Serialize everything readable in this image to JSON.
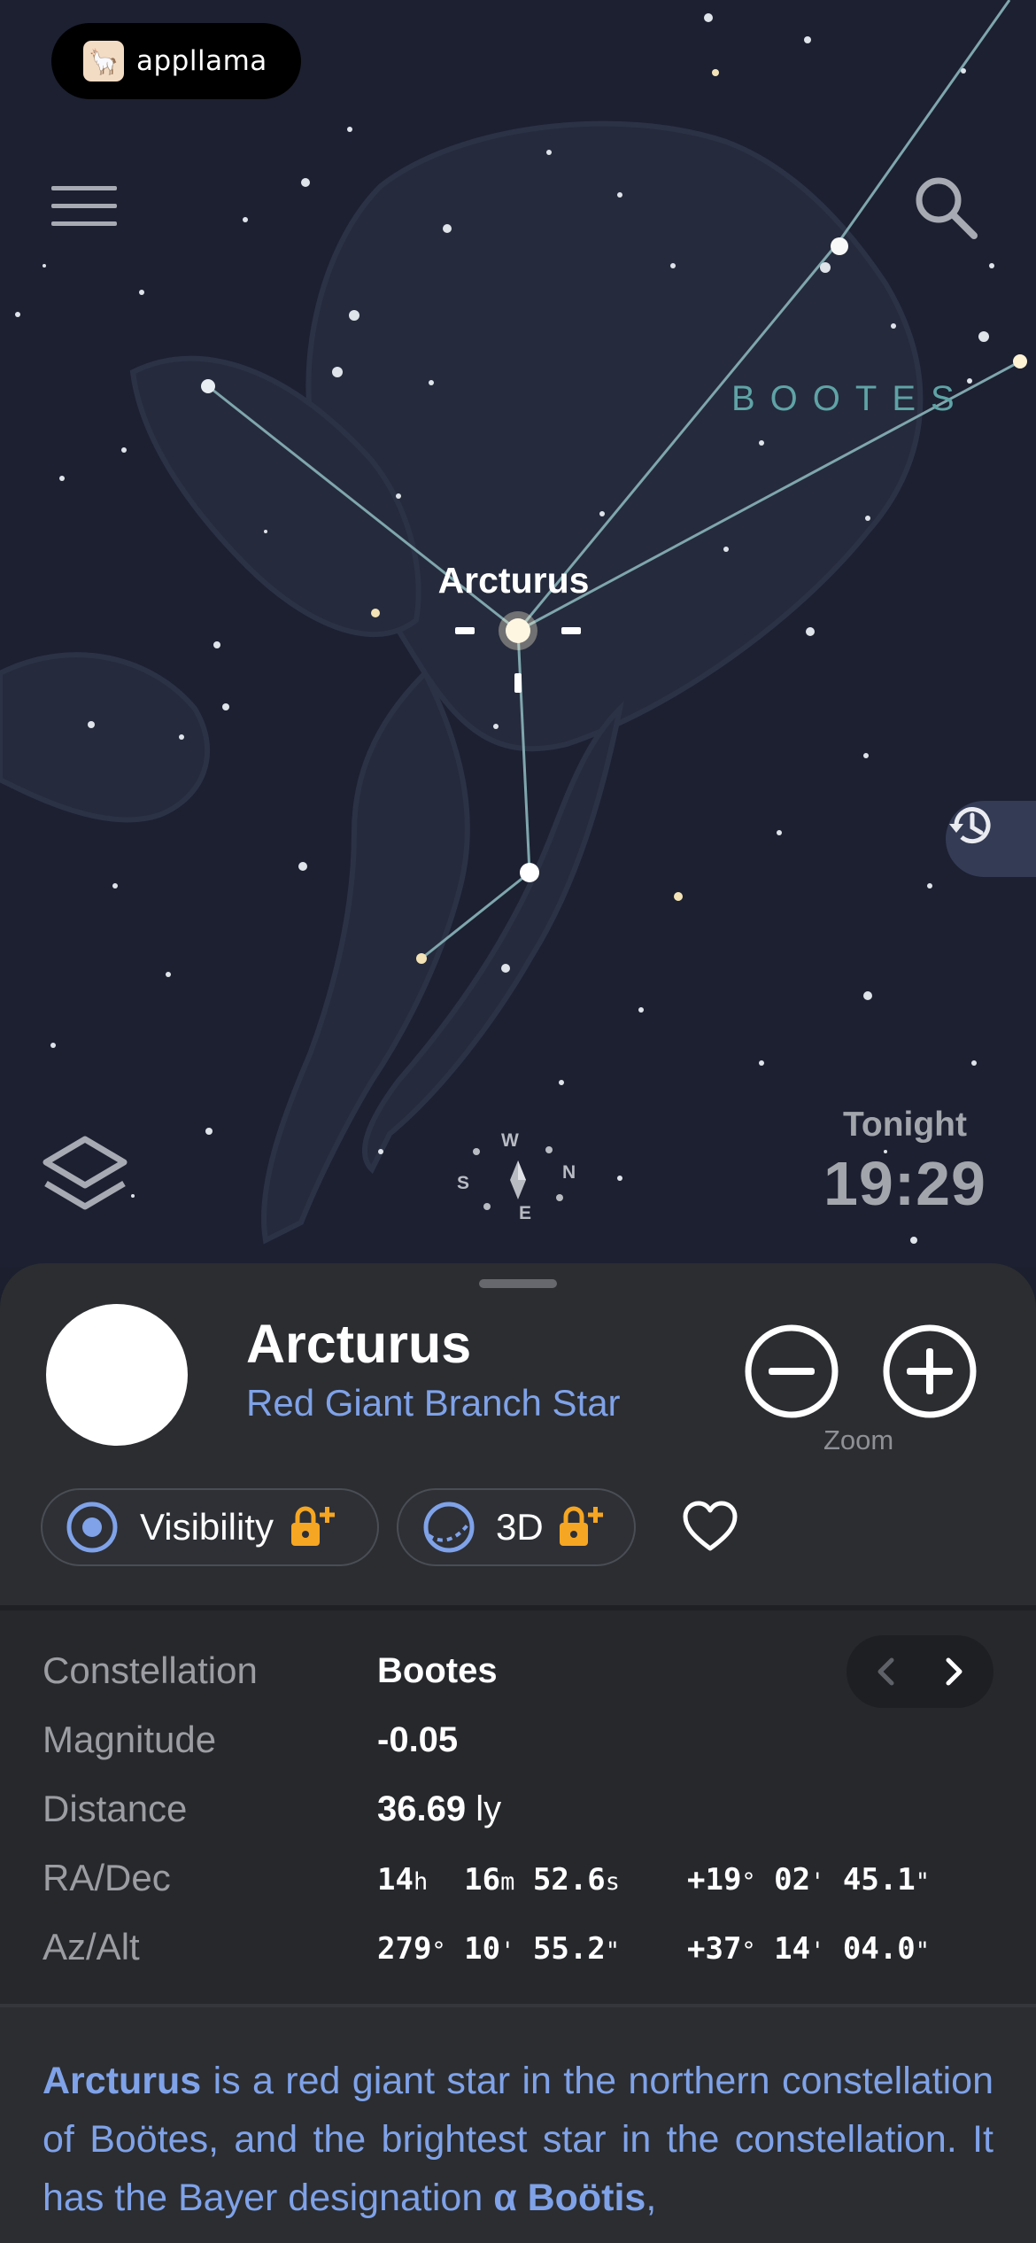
{
  "app": {
    "brand_name": "appllama"
  },
  "sky": {
    "constellation_label": "BOOTES",
    "selected_star_label": "Arcturus",
    "compass": {
      "w": "W",
      "s": "S",
      "n": "N",
      "e": "E"
    },
    "time": {
      "label": "Tonight",
      "value": "19:29"
    },
    "accent_line_color": "#7fa6ad"
  },
  "sheet": {
    "name": "Arcturus",
    "type": "Red Giant Branch Star",
    "zoom_label": "Zoom",
    "chips": [
      {
        "label": "Visibility",
        "icon": "target-icon",
        "locked": true
      },
      {
        "label": "3D",
        "icon": "orbit-icon",
        "locked": true
      }
    ],
    "properties": {
      "constellation": {
        "label": "Constellation",
        "value": "Bootes"
      },
      "magnitude": {
        "label": "Magnitude",
        "value": "-0.05"
      },
      "distance": {
        "label": "Distance",
        "value": "36.69",
        "unit": "ly"
      },
      "radec": {
        "label": "RA/Dec",
        "ra": {
          "h": "14",
          "h_unit": "h",
          "m": "16",
          "m_unit": "m",
          "s": "52.6",
          "s_unit": "s"
        },
        "dec": {
          "deg": "+19",
          "min": "02",
          "sec": "45.1"
        }
      },
      "azalt": {
        "label": "Az/Alt",
        "az": {
          "deg": "279",
          "min": "10",
          "sec": "55.2"
        },
        "alt": {
          "deg": "+37",
          "min": "14",
          "sec": "04.0"
        }
      }
    },
    "description": {
      "lead": "Arcturus",
      "text1": " is a red giant star in the northern constellation of Boötes, and the brightest star in the constellation. It has the Bayer designation ",
      "bayer": "α Boötis",
      "text2": ","
    },
    "accent_color": "#7fa2e8"
  }
}
